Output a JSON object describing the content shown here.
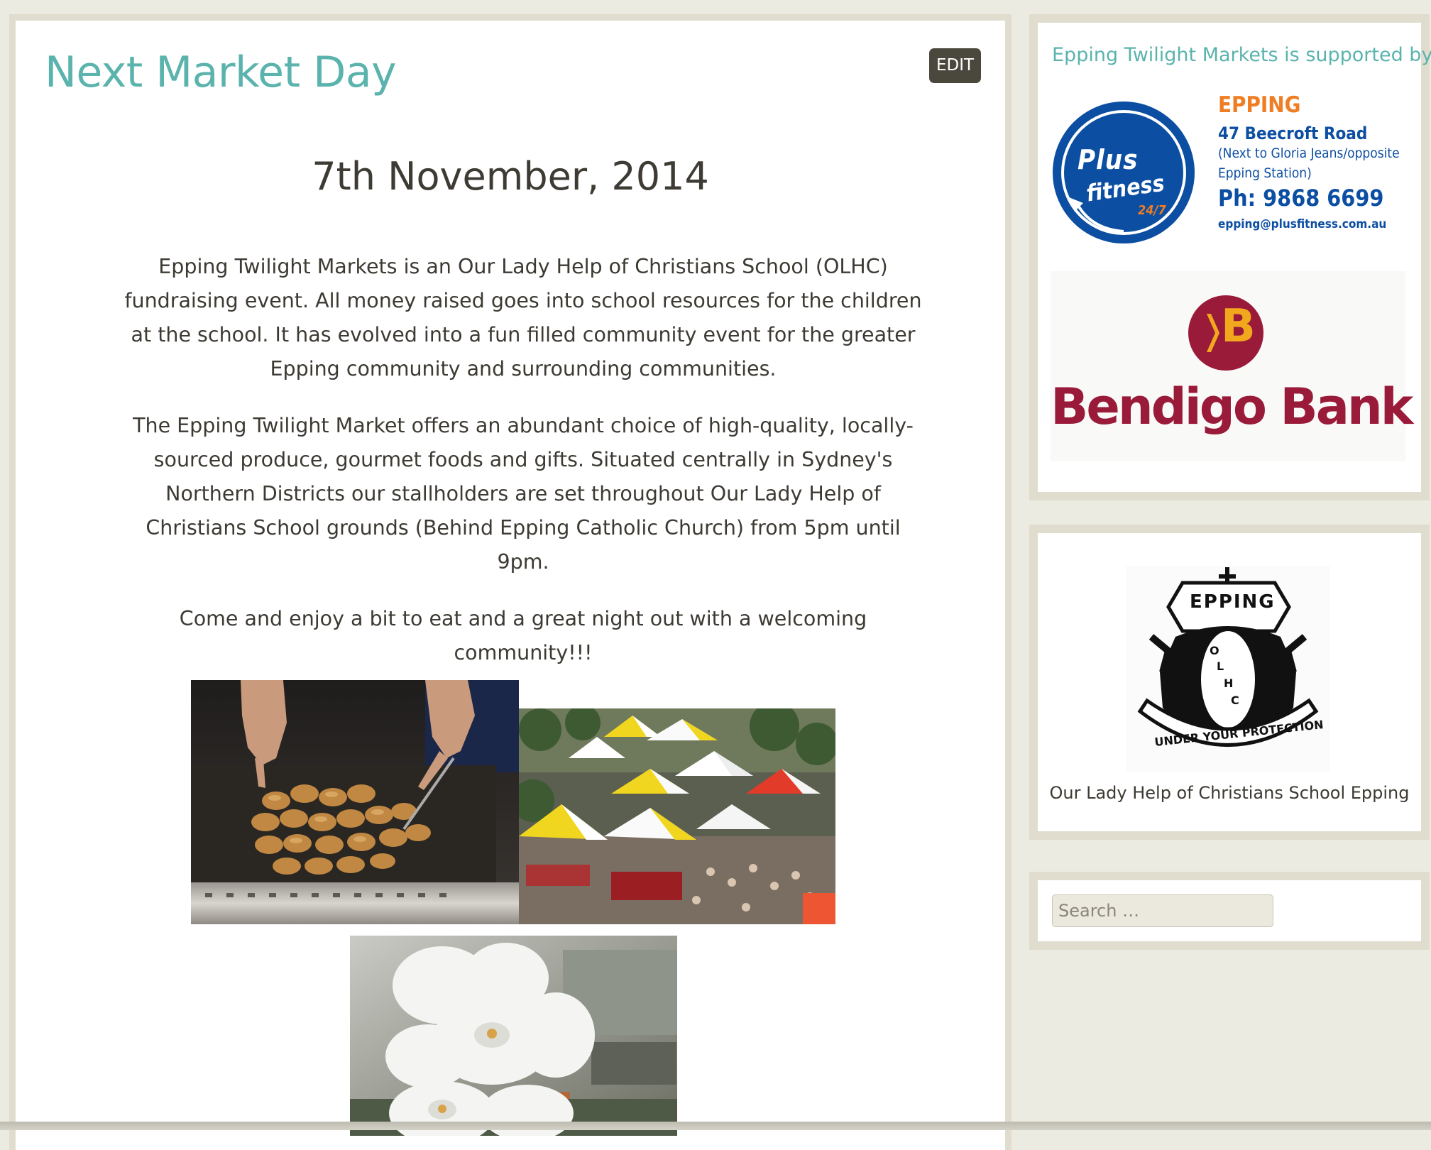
{
  "page": {
    "title": "Next Market Day",
    "edit_label": "EDIT",
    "date": "7th November, 2014",
    "paragraphs": [
      "Epping Twilight Markets is an Our Lady Help of Christians School (OLHC) fundraising event. All money raised goes into school resources for the children at the school. It has evolved into a fun filled community event for the greater Epping community and surrounding communities.",
      "The Epping Twilight Market offers an abundant choice of high-quality, locally-sourced produce, gourmet foods and gifts. Situated centrally in Sydney's Northern Districts our stallholders are set throughout Our Lady Help of Christians School grounds (Behind Epping Catholic Church) from 5pm until 9pm.",
      "Come and enjoy a bit to eat and a great night out with a welcoming community!!!"
    ]
  },
  "sidebar": {
    "sponsors_heading": "Epping Twilight Markets is supported by",
    "plus_fitness": {
      "logo_word_1": "Plus",
      "logo_word_2": "fitness",
      "logo_hours": "24/7",
      "location": "EPPING",
      "address": "47 Beecroft Road",
      "note_line_1": "(Next to Gloria Jeans/opposite",
      "note_line_2": "Epping Station)",
      "phone": "Ph: 9868 6699",
      "email": "epping@plusfitness.com.au"
    },
    "bendigo": {
      "name": "Bendigo Bank",
      "mark": "B"
    },
    "school": {
      "crest_top": "EPPING",
      "crest_letters": [
        "O",
        "L",
        "H",
        "C"
      ],
      "crest_motto": "UNDER YOUR PROTECTION",
      "caption": "Our Lady Help of Christians School Epping"
    },
    "search": {
      "placeholder": "Search …"
    }
  },
  "colors": {
    "accent_teal": "#5bb3ad",
    "background": "#ecebe1",
    "edit_button": "#4a473d",
    "bendigo_red": "#9a1a3a",
    "plus_blue": "#0b4ea2",
    "plus_orange": "#f07d22"
  }
}
